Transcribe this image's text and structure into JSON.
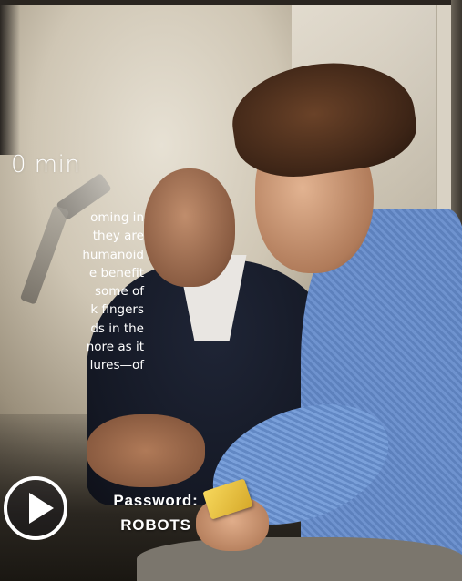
{
  "video_card": {
    "duration": "0 min",
    "description_lines": [
      "oming in",
      "they are",
      "humanoid",
      "e benefit",
      "some of",
      "k fingers",
      "ds in the",
      "nore as it",
      "lures—of"
    ],
    "play_icon": "play-icon",
    "password_label": "Password:",
    "password_value": "ROBOTS",
    "colors": {
      "overlay_text": "#ffffff",
      "shirt_blue": "#6f93cf",
      "cube_yellow": "#f0cc48"
    }
  }
}
